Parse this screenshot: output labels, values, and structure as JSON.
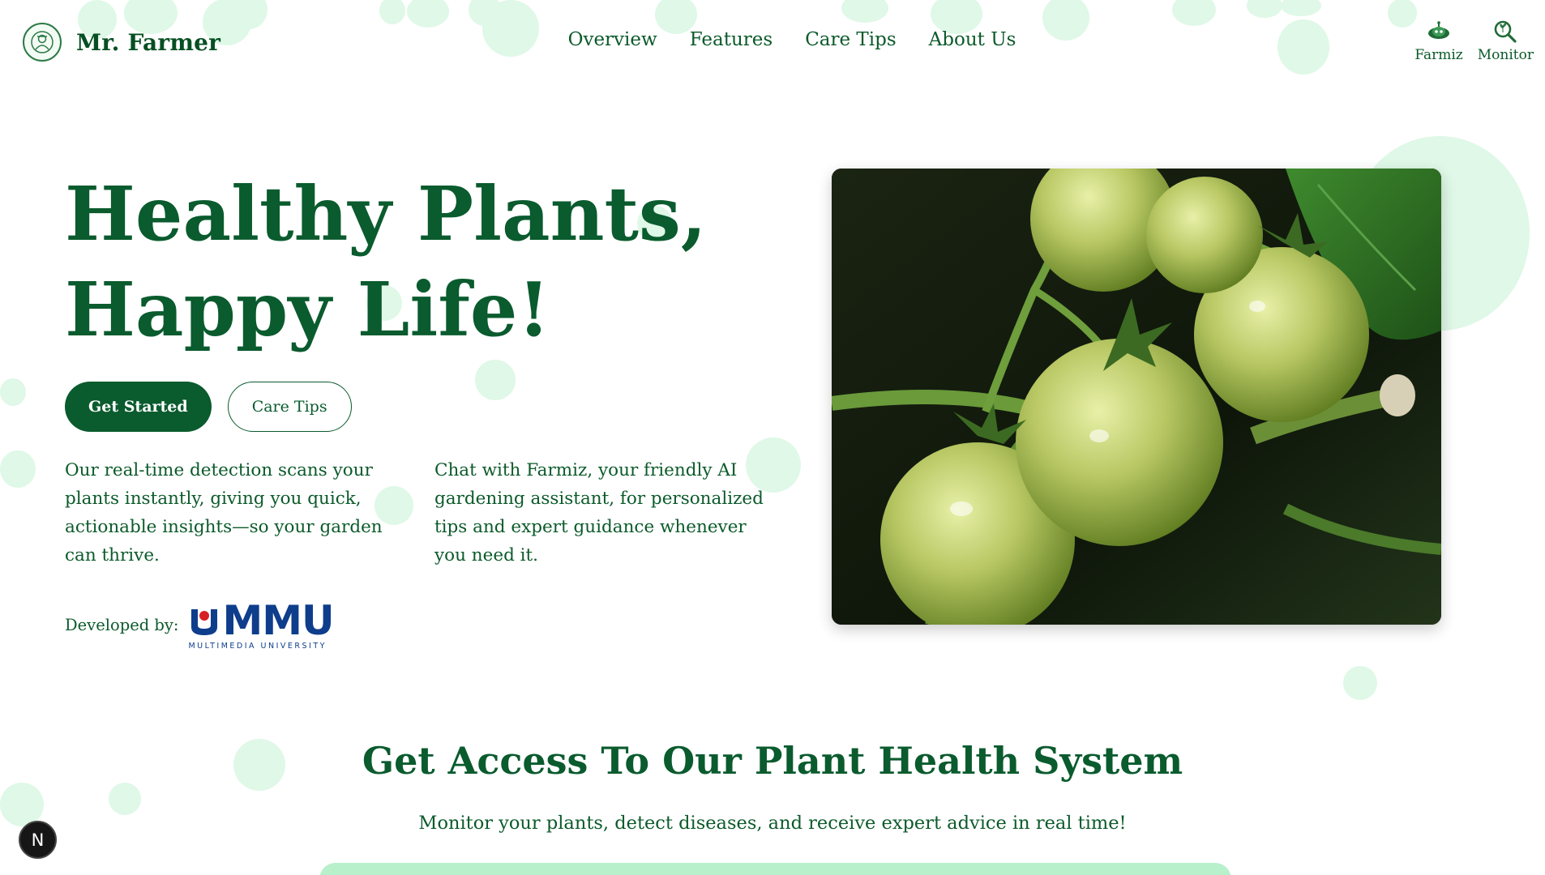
{
  "header": {
    "brand_name": "Mr. Farmer",
    "nav": [
      "Overview",
      "Features",
      "Care Tips",
      "About Us"
    ],
    "tools": [
      {
        "label": "Farmiz",
        "icon": "robot-icon"
      },
      {
        "label": "Monitor",
        "icon": "search-plant-icon"
      }
    ]
  },
  "hero": {
    "title_line1": "Healthy Plants,",
    "title_line2": "Happy Life!",
    "primary_button": "Get Started",
    "secondary_button": "Care Tips",
    "col1": "Our real-time detection scans your plants instantly, giving you quick, actionable insights—so your garden can thrive.",
    "col2": "Chat with Farmiz, your friendly AI gardening assistant, for personalized tips and expert guidance whenever you need it.",
    "developed_label": "Developed by:",
    "dev_logo_text": "MMU",
    "dev_logo_sub": "MULTIMEDIA UNIVERSITY"
  },
  "access": {
    "title": "Get Access To Our Plant Health System",
    "subtitle": "Monitor your plants, detect diseases, and receive expert advice in real time!"
  },
  "badge": {
    "letter": "N"
  },
  "colors": {
    "brand_green": "#0a5b2e",
    "bubble": "#dff8e7",
    "access_bar": "#b9f0cc",
    "mmu_blue": "#0e3d8c",
    "mmu_red": "#d71f26"
  }
}
